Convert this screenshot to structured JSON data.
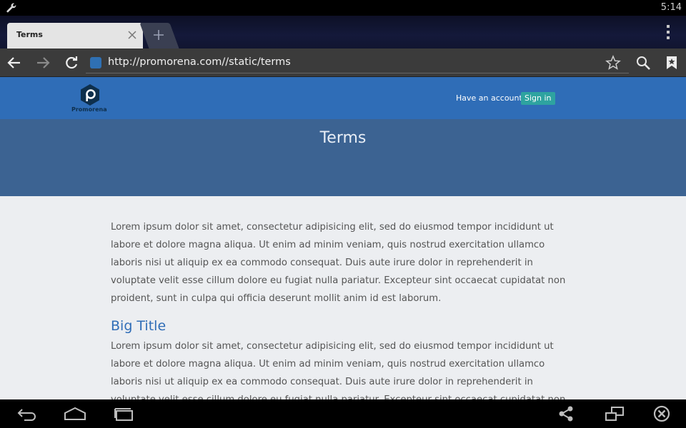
{
  "status_bar": {
    "time": "5:14",
    "icons": [
      "wrench-icon"
    ]
  },
  "browser": {
    "tab": {
      "title": "Terms"
    },
    "url": "http://promorena.com//static/terms",
    "icons": [
      "back-arrow-icon",
      "forward-arrow-icon",
      "reload-icon",
      "star-icon",
      "search-icon",
      "bookmarks-icon",
      "overflow-menu-icon"
    ]
  },
  "site": {
    "logo_text": "Promorena",
    "account_prompt": "Have an account?",
    "signin_label": "Sign in",
    "page_title": "Terms",
    "paragraph_1": "Lorem ipsum dolor sit amet, consectetur adipisicing elit, sed do eiusmod tempor incididunt ut labore et dolore magna aliqua. Ut enim ad minim veniam, quis nostrud exercitation ullamco laboris nisi ut aliquip ex ea commodo consequat. Duis aute irure dolor in reprehenderit in voluptate velit esse cillum dolore eu fugiat nulla pariatur. Excepteur sint occaecat cupidatat non proident, sunt in culpa qui officia deserunt mollit anim id est laborum.",
    "section_title": "Big Title",
    "paragraph_2": "Lorem ipsum dolor sit amet, consectetur adipisicing elit, sed do eiusmod tempor incididunt ut labore et dolore magna aliqua. Ut enim ad minim veniam, quis nostrud exercitation ullamco laboris nisi ut aliquip ex ea commodo consequat. Duis aute irure dolor in reprehenderit in voluptate velit esse cillum dolore eu fugiat nulla pariatur. Excepteur sint occaecat cupidatat non proident, sunt in culpa qui officia deserunt mollit anim id est laborum.",
    "colors": {
      "header": "#2f6db7",
      "hero": "#3c6392",
      "signin": "#2ea3a0",
      "background": "#eceef1"
    }
  },
  "nav_bar": {
    "icons": [
      "back-icon",
      "home-icon",
      "recent-apps-icon",
      "share-icon",
      "screen-rotate-icon",
      "close-circle-icon"
    ]
  }
}
